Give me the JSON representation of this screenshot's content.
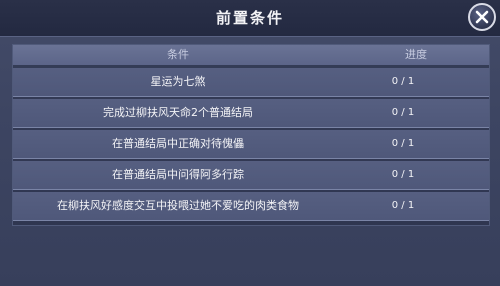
{
  "dialog": {
    "title": "前置条件"
  },
  "table": {
    "headers": {
      "condition": "条件",
      "progress": "进度"
    },
    "rows": [
      {
        "condition": "星运为七煞",
        "progress": "0 / 1"
      },
      {
        "condition": "完成过柳扶风天命2个普通结局",
        "progress": "0 / 1"
      },
      {
        "condition": "在普通结局中正确对待傀儡",
        "progress": "0 / 1"
      },
      {
        "condition": "在普通结局中问得阿多行踪",
        "progress": "0 / 1"
      },
      {
        "condition": "在柳扶风好感度交互中投喂过她不爱吃的肉类食物",
        "progress": "0 / 1"
      }
    ]
  },
  "icons": {
    "close": "close-icon"
  },
  "colors": {
    "title_bar": "#232941",
    "panel": "#3d4562",
    "row": "#525b7d",
    "header": "#6a7395"
  }
}
